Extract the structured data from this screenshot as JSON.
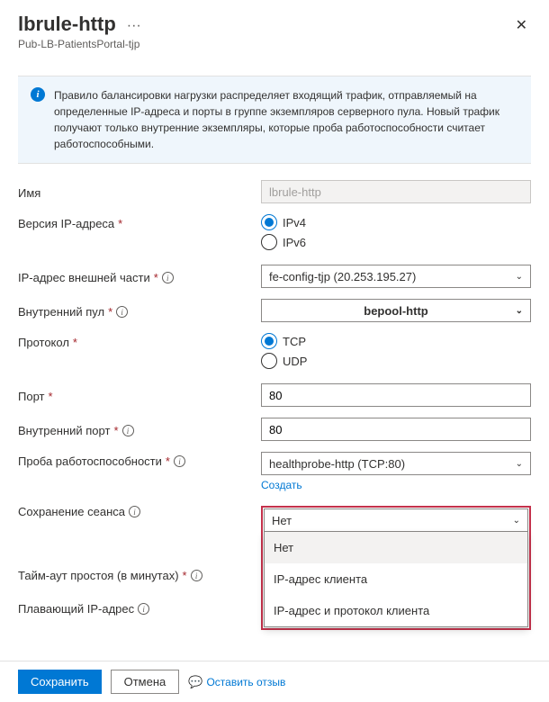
{
  "header": {
    "title": "lbrule-http",
    "subtitle": "Pub-LB-PatientsPortal-tjp"
  },
  "info": {
    "text": "Правило балансировки нагрузки распределяет входящий трафик, отправляемый на определенные IP-адреса и порты в группе экземпляров серверного пула. Новый трафик получают только внутренние экземпляры, которые проба работоспособности считает работоспособными."
  },
  "labels": {
    "name": "Имя",
    "ipVersion": "Версия IP-адреса",
    "frontendIp": "IP-адрес внешней части",
    "backendPool": "Внутренний пул",
    "protocol": "Протокол",
    "port": "Порт",
    "backendPort": "Внутренний порт",
    "healthProbe": "Проба работоспособности",
    "sessionPersistence": "Сохранение сеанса",
    "idleTimeout": "Тайм-аут простоя (в минутах)",
    "floatingIp": "Плавающий IP-адрес",
    "create": "Создать"
  },
  "values": {
    "name": "lbrule-http",
    "frontendIp": "fe-config-tjp (20.253.195.27)",
    "backendPool": "bepool-http",
    "port": "80",
    "backendPort": "80",
    "healthProbe": "healthprobe-http (TCP:80)",
    "sessionPersistence": "Нет"
  },
  "radios": {
    "ipv4": "IPv4",
    "ipv6": "IPv6",
    "tcp": "TCP",
    "udp": "UDP"
  },
  "dropdown": {
    "items": [
      "Нет",
      "IP-адрес клиента",
      "IP-адрес и протокол клиента"
    ]
  },
  "footer": {
    "save": "Сохранить",
    "cancel": "Отмена",
    "feedback": "Оставить отзыв"
  }
}
